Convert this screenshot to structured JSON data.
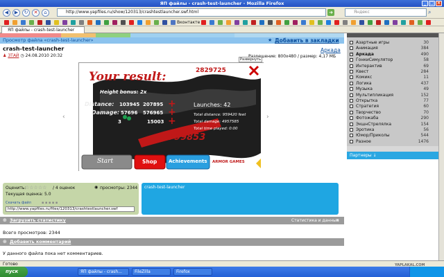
{
  "window": {
    "title": "ЯП файлы - crash-test-launcher - Mozilla Firefox"
  },
  "browser": {
    "url": "http://www.yapfiles.ru/show/120313/crashtestlauncher.swf.html",
    "search_placeholder": "Яндекс",
    "tab_title": "ЯП файлы - crash-test-launcher",
    "bookmarks": [
      "Вконтакте"
    ],
    "status": "Готово"
  },
  "page": {
    "breadcrumb": "Просмотр файла «crash-test-launcher»",
    "add_bookmark": "Добавить в закладки",
    "file_title": "crash-test-launcher",
    "author": "ЗТАЙ",
    "date": "24.08.2010 20:32",
    "category": "Аркада",
    "resolution_label": "Разрешение: 800x480 / размер: 4,17 МБ",
    "fullscreen_label": "Развернуть",
    "game": {
      "title": "Your result:",
      "score": "2829725",
      "height_bonus": "Height bonus: 2x",
      "distance_label": "Distance:",
      "distance_a": "103945",
      "distance_b": "207895",
      "damage_label": "Damage:",
      "damage_a": "57696",
      "damage_b": "576965",
      "money_count": "3",
      "money_value": "15003",
      "total": "799853",
      "launches": "Launches: 42",
      "total_distance": "Total distance: 959420 feet",
      "total_damage": "Total damage: 4957585",
      "total_time": "Total time played: 0:00",
      "btn_start": "Start",
      "btn_shop": "Shop",
      "btn_achievements": "Achievements",
      "logo": "ARMOR GAMES"
    },
    "rating": {
      "label": "Оценить:",
      "votes": "/ 4 оценок",
      "views": "просмотры: 2344",
      "current": "Текущая оценка: 5.0",
      "download_label": "Скачать файл",
      "embed_url": "http://www.yapfiles.ru/files/120313/crashtestlauncher.swf"
    },
    "blue_panel_title": "crash-test-launcher",
    "stats_header": "Загрузить статистику",
    "stats_right": "Статистика и данные",
    "total_views": "Всего просмотров: 2344",
    "comments_header": "Добавить комментарий",
    "no_comments": "У данного файла пока нет комментариев."
  },
  "sidebar": {
    "genres": [
      {
        "name": "Азартные игры",
        "count": "30"
      },
      {
        "name": "Анимация",
        "count": "384"
      },
      {
        "name": "Аркада",
        "count": "490",
        "checked": true
      },
      {
        "name": "ГонкиСимулятор",
        "count": "58"
      },
      {
        "name": "Интерактив",
        "count": "69"
      },
      {
        "name": "Квест",
        "count": "284"
      },
      {
        "name": "Комикс",
        "count": "11"
      },
      {
        "name": "Логика",
        "count": "437"
      },
      {
        "name": "Музыка",
        "count": "49"
      },
      {
        "name": "Мультипликация",
        "count": "152"
      },
      {
        "name": "Открытка",
        "count": "77"
      },
      {
        "name": "Стратегия",
        "count": "60"
      },
      {
        "name": "Творчество",
        "count": "70"
      },
      {
        "name": "Фотожаба",
        "count": "290"
      },
      {
        "name": "ЭкшнСтрелялка",
        "count": "154"
      },
      {
        "name": "Эротика",
        "count": "56"
      },
      {
        "name": "Юмор/Приколы",
        "count": "544"
      },
      {
        "name": "Разное",
        "count": "1476"
      }
    ],
    "partners_label": "Партнеры ↓"
  },
  "taskbar": {
    "start": "пуск",
    "items": [
      "ЯП файлы - crash...",
      "FileZilla",
      "Firefox"
    ],
    "tray": "YAPLAKAL.COM"
  },
  "colors": {
    "accent": "#1fa6e2",
    "header": "#8cc3ee",
    "gray": "#9b9b9b",
    "green": "#c5d6a8",
    "red": "#e02020"
  }
}
